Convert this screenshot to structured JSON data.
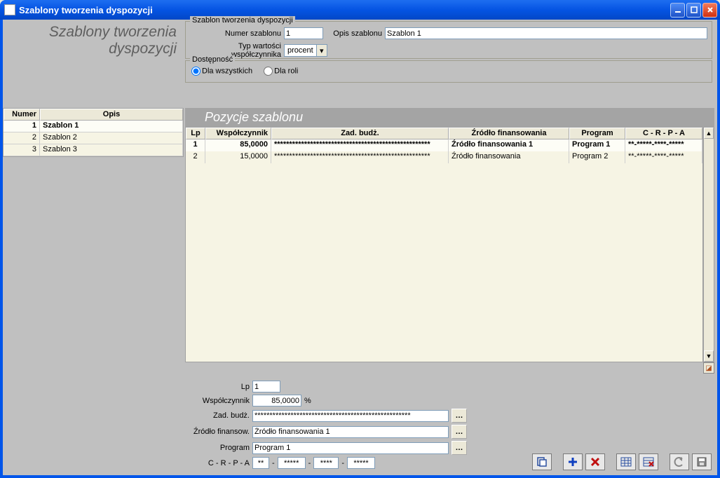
{
  "window": {
    "title": "Szablony tworzenia dyspozycji"
  },
  "region_title": "Szablony tworzenia dyspozycji",
  "szablon_box": {
    "legend": "Szablon tworzenia dyspozycji",
    "numer_label": "Numer szablonu",
    "numer_value": "1",
    "opis_label": "Opis szablonu",
    "opis_value": "Szablon 1",
    "typ_label": "Typ wartości współczynnika",
    "typ_value": "procent"
  },
  "dostep_box": {
    "legend": "Dostępność",
    "opt_all": "Dla wszystkich",
    "opt_role": "Dla roli"
  },
  "sidebar_grid": {
    "col_numer": "Numer",
    "col_opis": "Opis",
    "rows": [
      {
        "num": "1",
        "opis": "Szablon 1"
      },
      {
        "num": "2",
        "opis": "Szablon 2"
      },
      {
        "num": "3",
        "opis": "Szablon 3"
      }
    ]
  },
  "positions": {
    "title": "Pozycje szablonu",
    "col_lp": "Lp",
    "col_wsp": "Współczynnik",
    "col_zad": "Zad. budż.",
    "col_zr": "Źródło finansowania",
    "col_prg": "Program",
    "col_crpa": "C - R - P - A",
    "rows": [
      {
        "lp": "1",
        "wsp": "85,0000",
        "zad": "****************************************************",
        "zr": "Źródło finansowania 1",
        "prg": "Program 1",
        "crpa": "**-*****-****-*****"
      },
      {
        "lp": "2",
        "wsp": "15,0000",
        "zad": "****************************************************",
        "zr": "Źródło finansowania",
        "prg": "Program 2",
        "crpa": "**-*****-****-*****"
      }
    ]
  },
  "detail": {
    "lp_label": "Lp",
    "lp_value": "1",
    "wsp_label": "Współczynnik",
    "wsp_value": "85,0000",
    "wsp_suffix": "%",
    "zad_label": "Zad. budż.",
    "zad_value": "****************************************************",
    "zr_label": "Źródło finansow.",
    "zr_value": "Źródło finansowania 1",
    "prg_label": "Program",
    "prg_value": "Program 1",
    "crpa_label": "C - R - P - A",
    "crpa_sep": "-",
    "c_v": "**",
    "r_v": "*****",
    "p_v": "****",
    "a_v": "*****"
  }
}
